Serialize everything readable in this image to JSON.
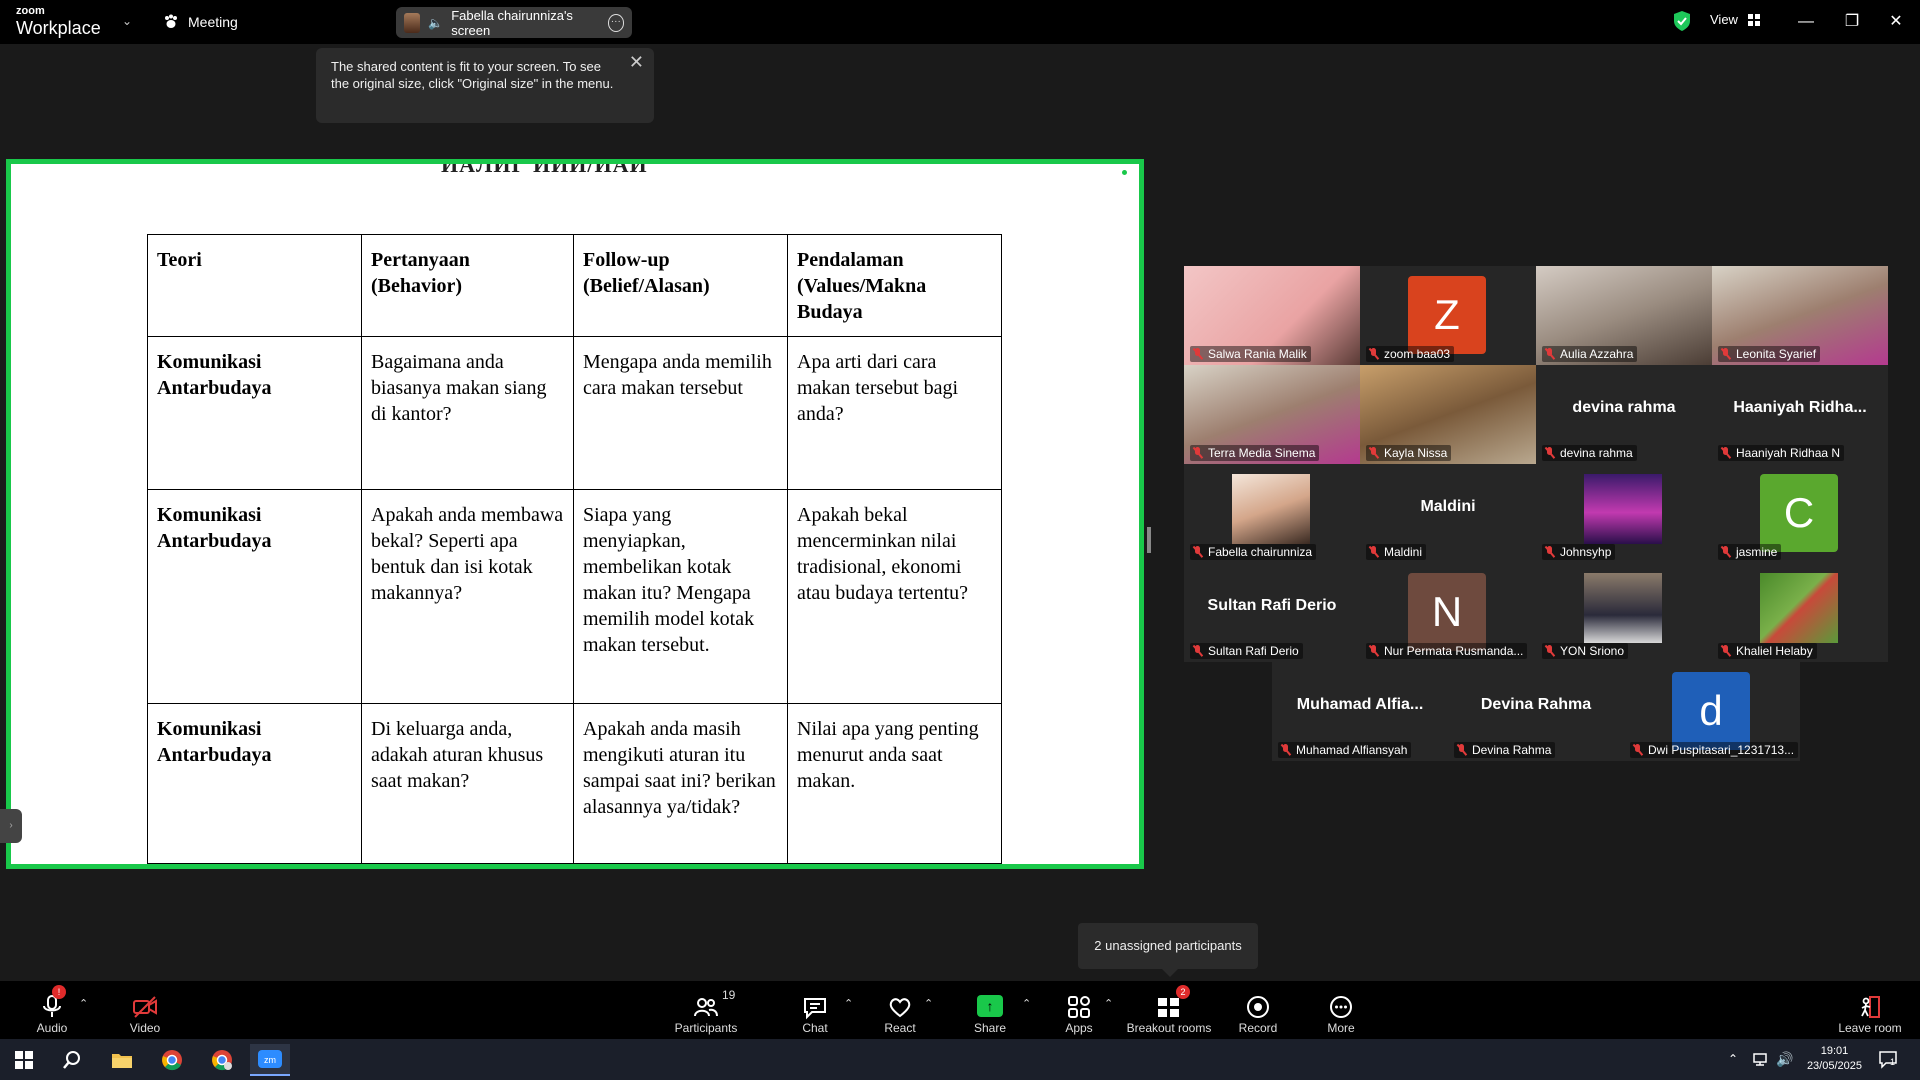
{
  "app": {
    "brand_small": "zoom",
    "brand_large": "Workplace",
    "meeting_label": "Meeting",
    "share_label": "Fabella chairunniza's screen",
    "view_label": "View"
  },
  "share_tooltip": "The shared content is fit to your screen. To see the original size, click \"Original size\" in the menu.",
  "document": {
    "title_cut": "ИАЛИГ ИИИ/ИАИ",
    "headers": [
      "Teori",
      "Pertanyaan (Behavior)",
      "Follow-up (Belief/Alasan)",
      "Pendalaman (Values/Makna Budaya"
    ],
    "rows": [
      [
        "Komunikasi Antarbudaya",
        "Bagaimana anda biasanya makan siang di kantor?",
        "Mengapa anda memilih cara makan tersebut",
        "Apa arti dari cara makan tersebut bagi anda?"
      ],
      [
        "Komunikasi Antarbudaya",
        "Apakah anda membawa bekal? Seperti apa bentuk dan isi kotak makannya?",
        "Siapa yang menyiapkan, membelikan kotak makan itu? Mengapa memilih model kotak makan tersebut.",
        "Apakah bekal mencerminkan nilai tradisional, ekonomi atau budaya tertentu?"
      ],
      [
        "Komunikasi Antarbudaya",
        "Di keluarga anda, adakah aturan khusus saat makan?",
        "Apakah anda masih mengikuti aturan itu sampai saat ini? berikan alasannya ya/tidak?",
        "Nilai apa yang penting menurut anda saat makan."
      ]
    ]
  },
  "participants": [
    {
      "name": "Salwa Rania Malik",
      "center": "",
      "initial": "",
      "kind": "video"
    },
    {
      "name": "zoom baa03",
      "center": "",
      "initial": "Z",
      "kind": "initial",
      "color": "#d9431e"
    },
    {
      "name": "Aulia Azzahra",
      "center": "",
      "initial": "",
      "kind": "video"
    },
    {
      "name": "Leonita Syarief",
      "center": "",
      "initial": "",
      "kind": "video",
      "active": true
    },
    {
      "name": "Terra Media Sinema",
      "center": "",
      "initial": "",
      "kind": "video"
    },
    {
      "name": "Kayla Nissa",
      "center": "",
      "initial": "",
      "kind": "video"
    },
    {
      "name": "devina rahma",
      "center": "devina rahma",
      "initial": "",
      "kind": "text"
    },
    {
      "name": "Haaniyah Ridhaa N",
      "center": "Haaniyah  Ridha...",
      "initial": "",
      "kind": "text"
    },
    {
      "name": "Fabella chairunniza",
      "center": "",
      "initial": "",
      "kind": "photo"
    },
    {
      "name": "Maldini",
      "center": "Maldini",
      "initial": "",
      "kind": "text"
    },
    {
      "name": "Johnsyhp",
      "center": "",
      "initial": "",
      "kind": "photo"
    },
    {
      "name": "jasmine",
      "center": "",
      "initial": "C",
      "kind": "initial",
      "color": "#5aa82e"
    },
    {
      "name": "Sultan Rafi Derio",
      "center": "Sultan Rafi Derio",
      "initial": "",
      "kind": "text"
    },
    {
      "name": "Nur Permata Rusmanda...",
      "center": "",
      "initial": "N",
      "kind": "initial",
      "color": "#6e4a3e"
    },
    {
      "name": "YON Sriono",
      "center": "",
      "initial": "",
      "kind": "photo"
    },
    {
      "name": "Khaliel Helaby",
      "center": "",
      "initial": "",
      "kind": "photo"
    },
    {
      "name": "Muhamad Alfiansyah",
      "center": "Muhamad  Alfia...",
      "initial": "",
      "kind": "text"
    },
    {
      "name": "Devina Rahma",
      "center": "Devina Rahma",
      "initial": "",
      "kind": "text"
    },
    {
      "name": "Dwi Puspitasari_1231713...",
      "center": "",
      "initial": "d",
      "kind": "initial",
      "color": "#1f5fb8"
    }
  ],
  "unassigned_tooltip": "2 unassigned participants",
  "toolbar": {
    "audio": "Audio",
    "video": "Video",
    "participants": "Participants",
    "participants_count": "19",
    "chat": "Chat",
    "react": "React",
    "share": "Share",
    "apps": "Apps",
    "breakout": "Breakout rooms",
    "breakout_badge": "2",
    "record": "Record",
    "more": "More",
    "leave": "Leave room"
  },
  "taskbar": {
    "time": "19:01",
    "date": "23/05/2025",
    "notif_count": "1"
  }
}
